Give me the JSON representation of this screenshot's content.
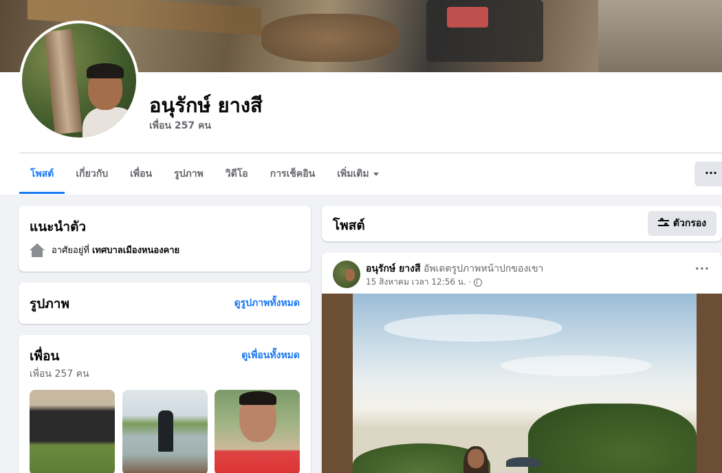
{
  "profile": {
    "name": "อนุรักษ์ ยางสี",
    "friend_count": "เพื่อน 257 คน"
  },
  "tabs": [
    {
      "label": "โพสต์",
      "active": true
    },
    {
      "label": "เกี่ยวกับ"
    },
    {
      "label": "เพื่อน"
    },
    {
      "label": "รูปภาพ"
    },
    {
      "label": "วิดีโอ"
    },
    {
      "label": "การเช็คอิน"
    },
    {
      "label": "เพิ่มเติม"
    }
  ],
  "more_button": "···",
  "intro": {
    "title": "แนะนำตัว",
    "lives_prefix": "อาศัยอยู่ที่",
    "lives_place": "เทศบาลเมืองหนองคาย"
  },
  "photos": {
    "title": "รูปภาพ",
    "see_all": "ดูรูปภาพทั้งหมด"
  },
  "friends": {
    "title": "เพื่อน",
    "see_all": "ดูเพื่อนทั้งหมด",
    "count": "เพื่อน 257 คน"
  },
  "posts_header": {
    "title": "โพสต์",
    "filter_label": "ตัวกรอง"
  },
  "post": {
    "author": "อนุรักษ์ ยางสี",
    "action": "อัพเดตรูปภาพหน้าปกของเขา",
    "time": "15 สิงหาคม เวลา 12:56 น. ·",
    "menu": "···"
  },
  "colors": {
    "accent": "#1877f2",
    "background": "#f0f2f5",
    "secondary_text": "#65676b"
  },
  "icons": [
    "home-icon",
    "filter-icon",
    "globe-icon",
    "caret-down-icon",
    "more-icon"
  ]
}
